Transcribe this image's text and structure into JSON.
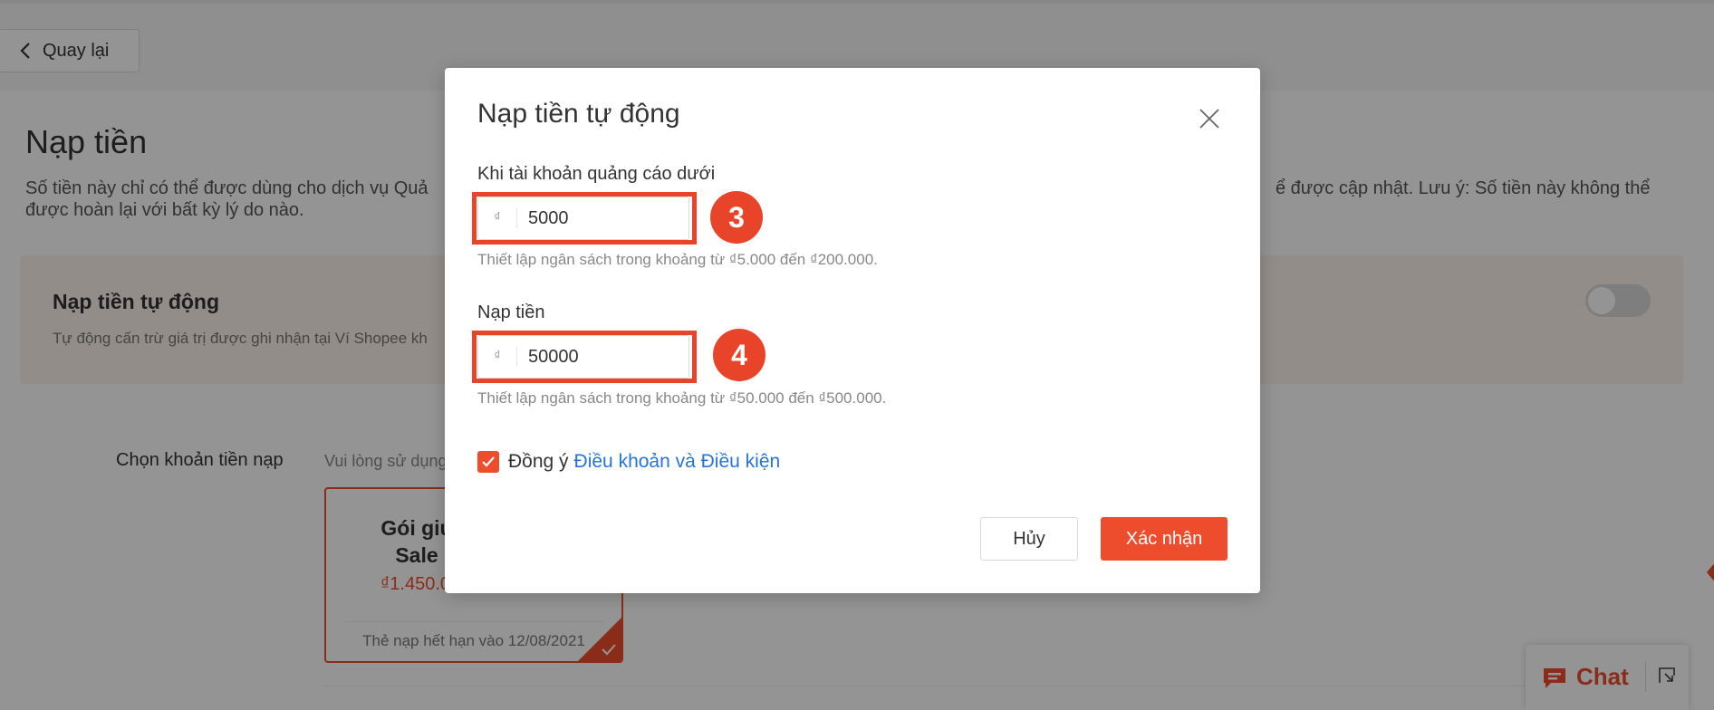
{
  "back_button": {
    "label": "Quay lại",
    "icon": "chevron-left-icon"
  },
  "page": {
    "title": "Nạp tiền",
    "description_left": "Số tiền này chỉ có thể được dùng cho dịch vụ Quả",
    "description_right": "ể được cập nhật. Lưu ý: Số tiền này không thể",
    "description_line2": "được hoàn lại với bất kỳ lý do nào."
  },
  "auto_topup_panel": {
    "title": "Nạp tiền tự động",
    "description": "Tự động cấn trừ giá trị được ghi nhận tại Ví Shopee kh",
    "toggle_on": false
  },
  "package_section": {
    "label": "Chọn khoản tiền nạp",
    "hint": "Vui lòng sử dụng",
    "card": {
      "name_line1": "Gói giú",
      "name_line2": "Sale",
      "price": "₫1.450.0",
      "expiry": "Thẻ nạp hết hạn vào 12/08/2021"
    }
  },
  "chat_widget": {
    "label": "Chat",
    "icon": "chat-bubble-icon",
    "expand_icon": "expand-icon"
  },
  "modal": {
    "title": "Nạp tiền tự động",
    "close_icon": "close-icon",
    "threshold": {
      "label": "Khi tài khoản quảng cáo dưới",
      "currency": "₫",
      "value": "5000",
      "hint": "Thiết lập ngân sách trong khoảng từ ₫5.000 đến ₫200.000.",
      "step_badge": "3"
    },
    "topup": {
      "label": "Nạp tiền",
      "currency": "₫",
      "value": "50000",
      "hint": "Thiết lập ngân sách trong khoảng từ ₫50.000 đến ₫500.000.",
      "step_badge": "4"
    },
    "agree": {
      "checked": true,
      "prefix": "Đồng ý",
      "link": "Điều khoản và Điều kiện"
    },
    "buttons": {
      "cancel": "Hủy",
      "confirm": "Xác nhận"
    }
  },
  "colors": {
    "brand": "#ee4d2d",
    "annotation": "#e8442a",
    "link": "#2673dd"
  }
}
